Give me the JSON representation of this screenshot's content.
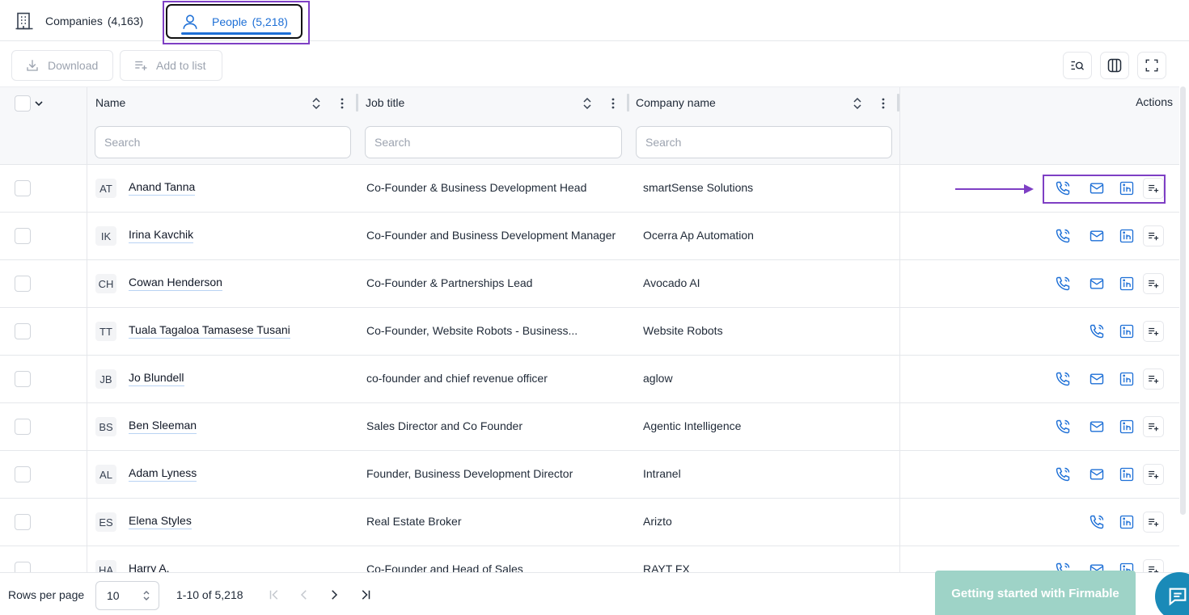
{
  "tabs": {
    "companies": {
      "label": "Companies",
      "count": "(4,163)"
    },
    "people": {
      "label": "People",
      "count": "(5,218)"
    }
  },
  "toolbar": {
    "download_label": "Download",
    "add_to_list_label": "Add to list",
    "icons": [
      "search-table-icon",
      "columns-icon",
      "fullscreen-icon"
    ]
  },
  "table": {
    "columns": {
      "name": "Name",
      "job_title": "Job title",
      "company_name": "Company name",
      "actions": "Actions"
    },
    "search_placeholder": "Search",
    "rows": [
      {
        "initials": "AT",
        "name": "Anand Tanna",
        "job": "Co-Founder & Business Development Head",
        "company": "smartSense Solutions",
        "has_email": true
      },
      {
        "initials": "IK",
        "name": "Irina Kavchik",
        "job": "Co-Founder and Business Development Manager",
        "company": "Ocerra Ap Automation",
        "has_email": true
      },
      {
        "initials": "CH",
        "name": "Cowan Henderson",
        "job": "Co-Founder & Partnerships Lead",
        "company": "Avocado AI",
        "has_email": true
      },
      {
        "initials": "TT",
        "name": "Tuala Tagaloa Tamasese Tusani",
        "job": "Co-Founder, Website Robots - Business...",
        "company": "Website Robots",
        "has_email": false
      },
      {
        "initials": "JB",
        "name": "Jo Blundell",
        "job": "co-founder and chief revenue officer",
        "company": "aglow",
        "has_email": true
      },
      {
        "initials": "BS",
        "name": "Ben Sleeman",
        "job": "Sales Director and Co Founder",
        "company": "Agentic Intelligence",
        "has_email": true
      },
      {
        "initials": "AL",
        "name": "Adam Lyness",
        "job": "Founder, Business Development Director",
        "company": "Intranel",
        "has_email": true
      },
      {
        "initials": "ES",
        "name": "Elena Styles",
        "job": "Real Estate Broker",
        "company": "Arizto",
        "has_email": false
      },
      {
        "initials": "HA",
        "name": "Harry A.",
        "job": "Co-Founder and Head of Sales",
        "company": "RAYT FX",
        "has_email": true
      }
    ]
  },
  "footer": {
    "rows_per_page_label": "Rows per page",
    "rows_per_page_value": "10",
    "range": "1-10 of 5,218",
    "getting_started": "Getting started with Firmable"
  },
  "colors": {
    "accent": "#1d6fd6",
    "highlight": "#7e3fc4",
    "getting_started_bg": "#9ed3c7",
    "chat_bg": "#1a8ab8"
  }
}
